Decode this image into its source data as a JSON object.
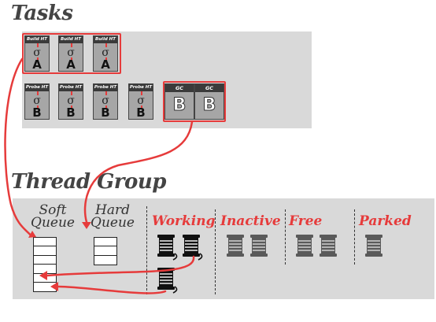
{
  "titles": {
    "tasks": "Tasks",
    "thread_group": "Thread Group"
  },
  "build_cards": [
    {
      "header": "Build HT",
      "op": "σ",
      "input": "A"
    },
    {
      "header": "Build HT",
      "op": "σ",
      "input": "A"
    },
    {
      "header": "Build HT",
      "op": "σ",
      "input": "A"
    }
  ],
  "probe_cards": [
    {
      "header": "Probe HT",
      "op": "σ",
      "input": "B"
    },
    {
      "header": "Probe HT",
      "op": "σ",
      "input": "B"
    },
    {
      "header": "Probe HT",
      "op": "σ",
      "input": "B"
    },
    {
      "header": "Probe HT",
      "op": "σ",
      "input": "B"
    }
  ],
  "gc_cards": [
    {
      "header": "GC",
      "input": "B"
    },
    {
      "header": "GC",
      "input": "B"
    }
  ],
  "queues": {
    "soft": "Soft\nQueue",
    "hard": "Hard\nQueue",
    "soft_slots": 5,
    "hard_slots": 3
  },
  "states": {
    "working": "Working",
    "inactive": "Inactive",
    "free": "Free",
    "parked": "Parked"
  },
  "colors": {
    "accent": "#e63b3b",
    "panel": "#d9d9d9",
    "card": "#a6a6a6"
  },
  "threads": {
    "working": 3,
    "inactive": 2,
    "free": 2,
    "parked": 1
  }
}
